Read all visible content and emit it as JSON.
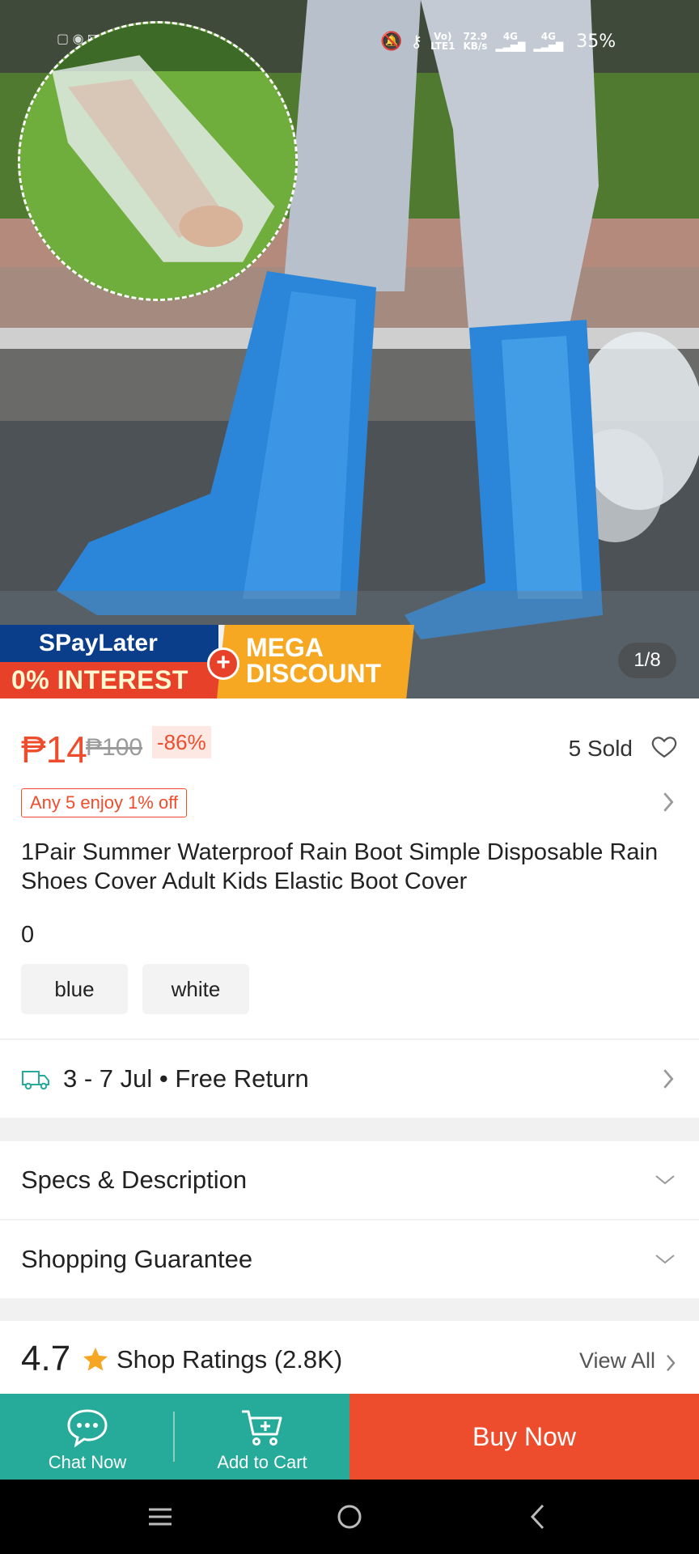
{
  "status_bar": {
    "signal_vo": "Vo)",
    "signal_lte": "LTE1",
    "speed_value": "72.9",
    "speed_unit": "KB/s",
    "net1": "4G",
    "net2": "4G",
    "battery": "35%"
  },
  "gallery": {
    "counter": "1/8",
    "promo_spay": "SPayLater",
    "promo_interest": "0% INTEREST",
    "promo_plus": "+",
    "promo_mega_line1": "MEGA",
    "promo_mega_line2": "DISCOUNT"
  },
  "product": {
    "price": "₱14",
    "original_price": "₱100",
    "discount": "-86%",
    "sold": "5 Sold",
    "promo_tag": "Any 5 enjoy 1% off",
    "title": "1Pair Summer Waterproof Rain Boot Simple Disposable Rain Shoes Cover Adult Kids Elastic Boot Cover",
    "variant_price": "0",
    "variants": [
      "blue",
      "white"
    ]
  },
  "delivery": {
    "text": "3 - 7 Jul • Free Return"
  },
  "sections": {
    "specs": "Specs & Description",
    "guarantee": "Shopping Guarantee"
  },
  "ratings": {
    "score": "4.7",
    "label": "Shop Ratings (2.8K)",
    "view_all": "View All"
  },
  "actions": {
    "chat": "Chat Now",
    "cart": "Add to Cart",
    "buy": "Buy Now"
  },
  "colors": {
    "accent": "#ee4d2d",
    "teal": "#26aa99",
    "star": "#f5a623"
  }
}
